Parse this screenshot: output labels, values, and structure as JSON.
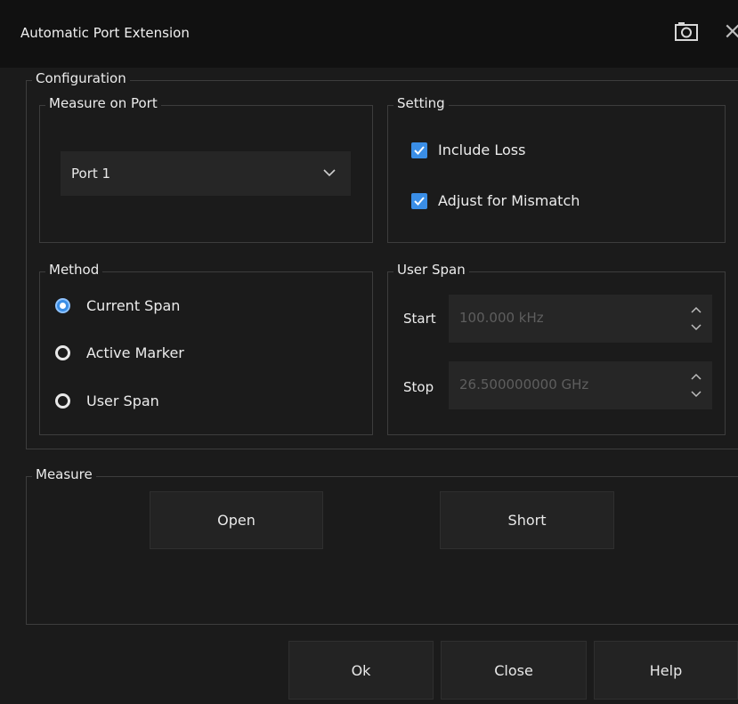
{
  "window": {
    "title": "Automatic Port Extension",
    "camera_icon": "camera-icon",
    "close_icon": "close-icon"
  },
  "configuration": {
    "legend": "Configuration",
    "measure_on_port": {
      "legend": "Measure on Port",
      "selected": "Port 1"
    },
    "setting": {
      "legend": "Setting",
      "options": [
        {
          "label": "Include Loss",
          "checked": true
        },
        {
          "label": "Adjust for Mismatch",
          "checked": true
        }
      ]
    },
    "method": {
      "legend": "Method",
      "options": [
        {
          "label": "Current Span",
          "selected": true
        },
        {
          "label": "Active Marker",
          "selected": false
        },
        {
          "label": "User Span",
          "selected": false
        }
      ]
    },
    "user_span": {
      "legend": "User Span",
      "start": {
        "label": "Start",
        "value": "100.000 kHz"
      },
      "stop": {
        "label": "Stop",
        "value": "26.500000000 GHz"
      }
    }
  },
  "measure": {
    "legend": "Measure",
    "open_label": "Open",
    "short_label": "Short"
  },
  "footer": {
    "ok_label": "Ok",
    "close_label": "Close",
    "help_label": "Help"
  },
  "colors": {
    "accent": "#3a8ee6",
    "background": "#1b1b1b",
    "titlebar": "#111111"
  }
}
